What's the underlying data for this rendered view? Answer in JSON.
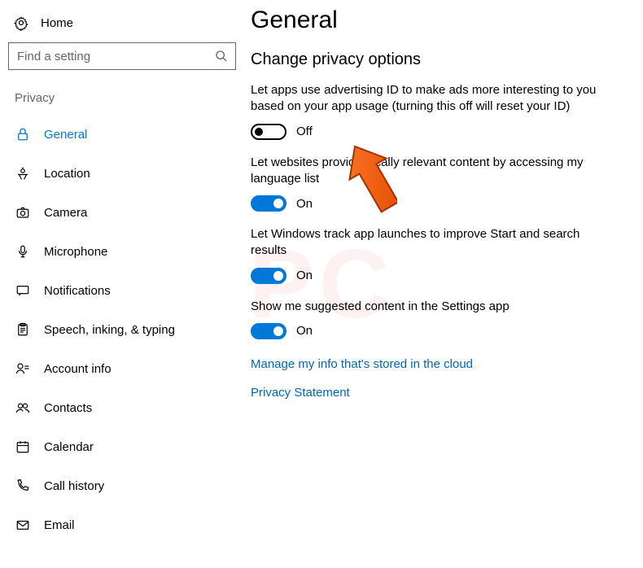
{
  "sidebar": {
    "home_label": "Home",
    "search_placeholder": "Find a setting",
    "section_label": "Privacy",
    "items": [
      {
        "label": "General",
        "icon": "lock-icon",
        "active": true
      },
      {
        "label": "Location",
        "icon": "location-icon",
        "active": false
      },
      {
        "label": "Camera",
        "icon": "camera-icon",
        "active": false
      },
      {
        "label": "Microphone",
        "icon": "microphone-icon",
        "active": false
      },
      {
        "label": "Notifications",
        "icon": "notifications-icon",
        "active": false
      },
      {
        "label": "Speech, inking, & typing",
        "icon": "clipboard-icon",
        "active": false
      },
      {
        "label": "Account info",
        "icon": "account-icon",
        "active": false
      },
      {
        "label": "Contacts",
        "icon": "contacts-icon",
        "active": false
      },
      {
        "label": "Calendar",
        "icon": "calendar-icon",
        "active": false
      },
      {
        "label": "Call history",
        "icon": "phone-icon",
        "active": false
      },
      {
        "label": "Email",
        "icon": "email-icon",
        "active": false
      }
    ]
  },
  "main": {
    "title": "General",
    "subtitle": "Change privacy options",
    "options": [
      {
        "desc": "Let apps use advertising ID to make ads more interesting to you based on your app usage (turning this off will reset your ID)",
        "state": "Off"
      },
      {
        "desc": "Let websites provide locally relevant content by accessing my language list",
        "state": "On"
      },
      {
        "desc": "Let Windows track app launches to improve Start and search results",
        "state": "On"
      },
      {
        "desc": "Show me suggested content in the Settings app",
        "state": "On"
      }
    ],
    "links": {
      "cloud_info": "Manage my info that's stored in the cloud",
      "privacy_statement": "Privacy Statement"
    }
  },
  "annotation": {
    "arrow_target": "advertising-id-toggle"
  }
}
